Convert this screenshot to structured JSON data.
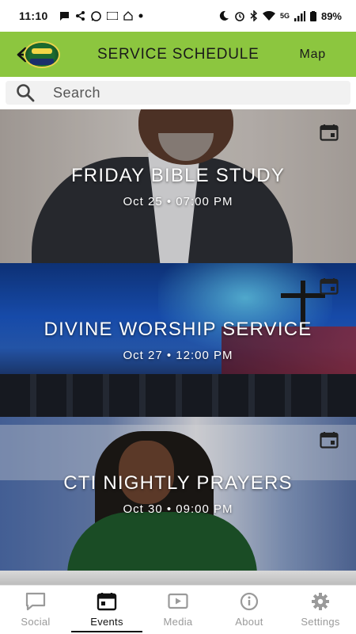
{
  "status_bar": {
    "time": "11:10",
    "battery": "89%",
    "network": "5G"
  },
  "app_bar": {
    "title": "SERVICE SCHEDULE",
    "map_label": "Map",
    "accent_color": "#8cc63f"
  },
  "search": {
    "placeholder": "Search",
    "value": ""
  },
  "events": [
    {
      "title": "FRIDAY BIBLE STUDY",
      "date": "Oct 25 • 07:00 PM",
      "icon": "calendar-add-icon"
    },
    {
      "title": "DIVINE WORSHIP SERVICE",
      "date": "Oct 27 • 12:00 PM",
      "icon": "calendar-add-icon"
    },
    {
      "title": "CTI NIGHTLY PRAYERS",
      "date": "Oct 30 • 09:00 PM",
      "icon": "calendar-add-icon"
    }
  ],
  "bottom_nav": {
    "items": [
      {
        "label": "Social",
        "icon": "chat-bubble-icon",
        "active": false
      },
      {
        "label": "Events",
        "icon": "calendar-icon",
        "active": true
      },
      {
        "label": "Media",
        "icon": "play-icon",
        "active": false
      },
      {
        "label": "About",
        "icon": "info-icon",
        "active": false
      },
      {
        "label": "Settings",
        "icon": "gear-icon",
        "active": false
      }
    ]
  }
}
